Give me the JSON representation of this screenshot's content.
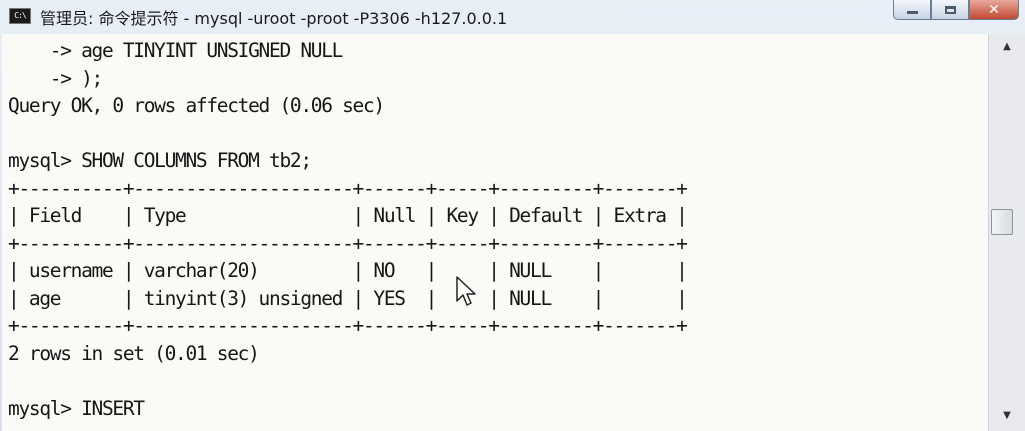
{
  "window": {
    "title": "管理员: 命令提示符 - mysql  -uroot -proot -P3306 -h127.0.0.1",
    "icon": "console-app-icon",
    "icon_text": "C:\\",
    "caption_buttons": [
      "minimize-icon",
      "maximize-icon",
      "close-icon"
    ],
    "close_glyph": "✕"
  },
  "console": {
    "lines": [
      "    -> age TINYINT UNSIGNED NULL",
      "    -> );",
      "Query OK, 0 rows affected (0.06 sec)",
      "",
      "mysql> SHOW COLUMNS FROM tb2;",
      "+----------+---------------------+------+-----+---------+-------+",
      "| Field    | Type                | Null | Key | Default | Extra |",
      "+----------+---------------------+------+-----+---------+-------+",
      "| username | varchar(20)         | NO   |     | NULL    |       |",
      "| age      | tinyint(3) unsigned | YES  |     | NULL    |       |",
      "+----------+---------------------+------+-----+---------+-------+",
      "2 rows in set (0.01 sec)",
      "",
      "mysql> INSERT"
    ]
  },
  "scrollbar": {
    "up_arrow": "▲",
    "down_arrow": "▼"
  },
  "colors": {
    "console_background": "#fafaf7",
    "console_text": "#161616",
    "close_button": "#c24a32"
  }
}
